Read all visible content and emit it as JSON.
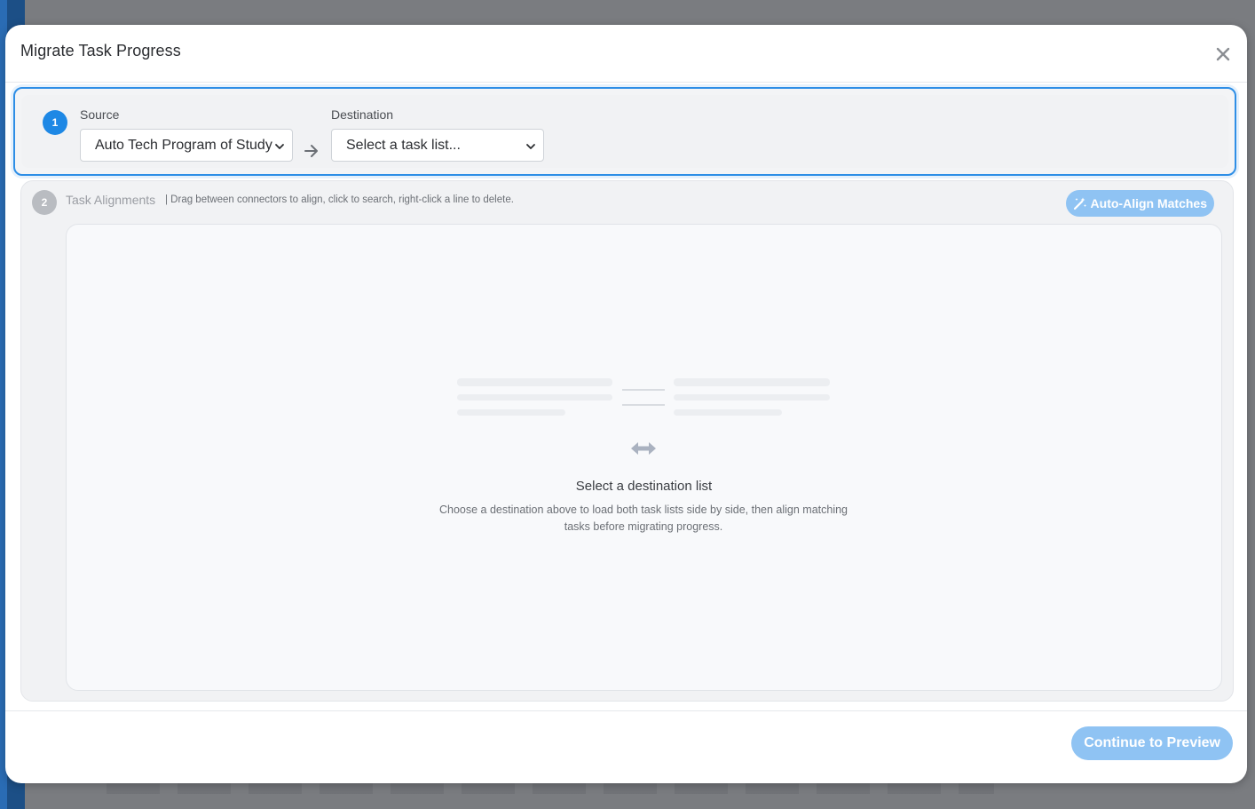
{
  "modal": {
    "title": "Migrate Task Progress"
  },
  "step1": {
    "number": "1",
    "source_label": "Source",
    "source_value": "Auto Tech Program of Study",
    "destination_label": "Destination",
    "destination_value": "Select a task list..."
  },
  "step2": {
    "number": "2",
    "title": "Task Alignments",
    "hint": "| Drag between connectors to align, click to search, right-click a line to delete.",
    "auto_align_label": "Auto-Align Matches",
    "empty_title": "Select a destination list",
    "empty_description": "Choose a destination above to load both task lists side by side, then align matching tasks before migrating progress."
  },
  "footer": {
    "continue_label": "Continue to Preview"
  },
  "colors": {
    "accent": "#1e88e5",
    "accent_disabled": "#8fc3f3",
    "step_muted": "#b9bcc1"
  },
  "icons": [
    "close-icon",
    "arrow-right-icon",
    "chevron-down-icon",
    "magic-wand-icon",
    "swap-horizontal-icon"
  ]
}
